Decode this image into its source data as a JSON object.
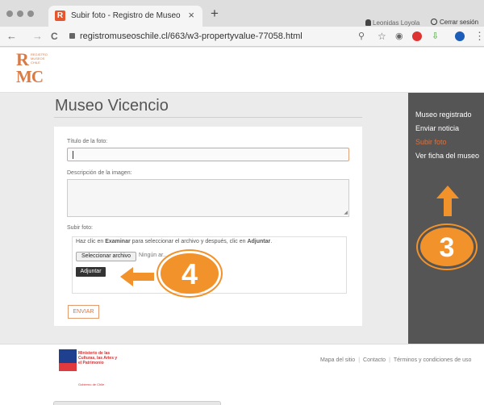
{
  "browser": {
    "tab_title": "Subir foto - Registro de Museo",
    "tab_close": "×",
    "new_tab": "+",
    "back": "←",
    "forward": "→",
    "reload": "C",
    "url": "registromuseoschile.cl/663/w3-propertyvalue-77058.html",
    "zoom_icon": "search-icon",
    "star": "☆",
    "menu": "⋮"
  },
  "header": {
    "logo_letters_top": "R",
    "logo_letters_bottom": "MC",
    "logo_small_text": "REGISTRO MUSEOS CHILE",
    "user_name": "Leonidas Loyola",
    "logout_label": "Cerrar sesión"
  },
  "main": {
    "page_title": "Museo Vicencio",
    "form": {
      "title_label": "Título de la foto:",
      "title_value": "",
      "description_label": "Descripción de la imagen:",
      "description_value": "",
      "upload_label": "Subir foto:",
      "upload_help_prefix": "Haz clic en ",
      "upload_help_examinar": "Examinar",
      "upload_help_middle": " para seleccionar el archivo y después, clic en ",
      "upload_help_adjuntar": "Adjuntar",
      "upload_help_suffix": ".",
      "file_button_label": "Seleccionar archivo",
      "file_none_label": "Ningún ar...",
      "attach_button_label": "Adjuntar",
      "send_button_label": "ENVIAR"
    }
  },
  "sidebar": {
    "items": [
      {
        "label": "Museo registrado",
        "active": false
      },
      {
        "label": "Enviar noticia",
        "active": false
      },
      {
        "label": "Subir foto",
        "active": true
      },
      {
        "label": "Ver ficha del museo",
        "active": false
      }
    ]
  },
  "annotations": {
    "step_3": "3",
    "step_4": "4",
    "accent_color": "#f2922b"
  },
  "footer": {
    "ministry_name": "Ministerio de las Culturas, las Artes y el Patrimonio",
    "ministry_slogan": "Gobierno de Chile",
    "links": [
      "Mapa del sitio",
      "Contacto",
      "Términos y condiciones de uso"
    ]
  },
  "colors": {
    "brand_orange": "#d87b47",
    "sidebar_bg": "#555555",
    "active_link": "#e06f3a"
  }
}
